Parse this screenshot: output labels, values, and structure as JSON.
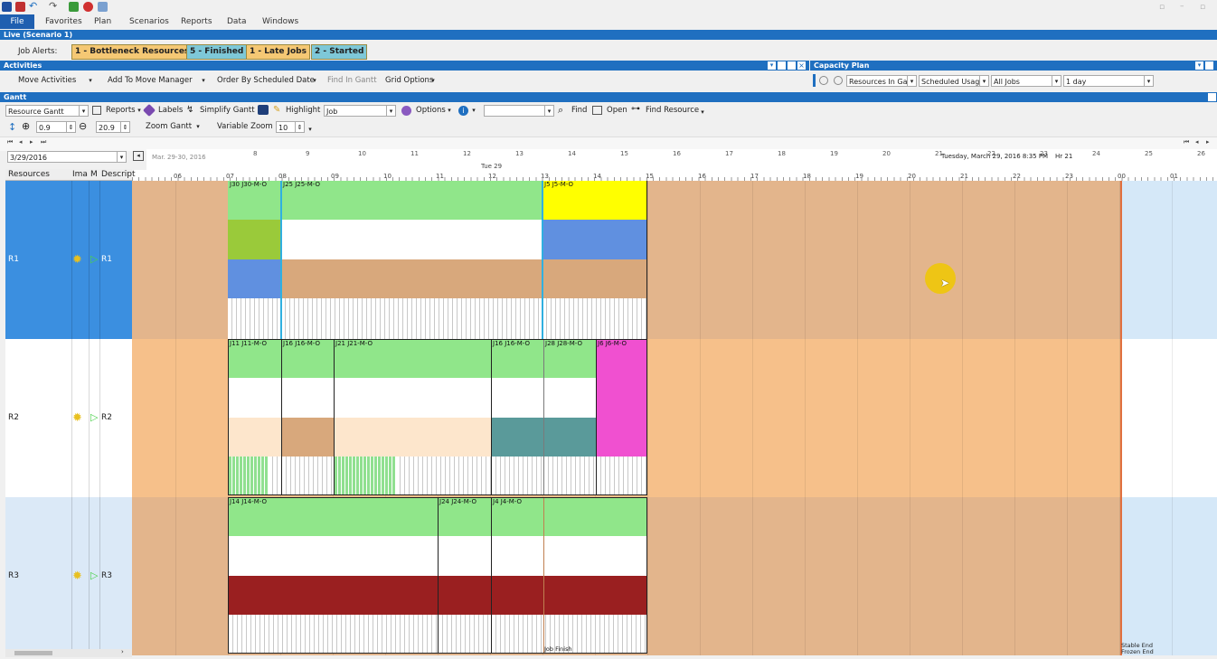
{
  "window": {
    "title_controls": [
      "restore",
      "minimize",
      "maximize"
    ]
  },
  "menu": [
    "File",
    "Favorites",
    "Plan",
    "Scenarios",
    "Reports",
    "Data",
    "Windows"
  ],
  "scenario_bar": "Live (Scenario 1)",
  "alerts": {
    "label": "Job Alerts:",
    "items": [
      {
        "label": "1 - Bottleneck Resources",
        "color": "#f5c874"
      },
      {
        "label": "5 - Finished",
        "color": "#7ec8d8"
      },
      {
        "label": "1 - Late Jobs",
        "color": "#f5c874"
      },
      {
        "label": "2 - Started",
        "color": "#7ec8d8"
      }
    ]
  },
  "activities": {
    "title": "Activities",
    "move_activities": "Move Activities",
    "add_to_move_manager": "Add To Move Manager",
    "order_by": "Order By Scheduled Date",
    "find_in_gantt": "Find In Gantt",
    "grid_options": "Grid Options"
  },
  "capacity_plan": {
    "title": "Capacity Plan",
    "resources": "Resources In Ga",
    "usage": "Scheduled Usag",
    "jobs": "All Jobs",
    "period": "1 day"
  },
  "gantt": {
    "title": "Gantt",
    "view": "Resource Gantt",
    "reports": "Reports",
    "labels": "Labels",
    "simplify": "Simplify Gantt",
    "highlight": "Highlight",
    "highlight_value": "Job",
    "options": "Options",
    "find": "Find",
    "open": "Open",
    "find_resource": "Find Resource",
    "zoom1": "0.9",
    "zoom2": "20.9",
    "zoom_gantt": "Zoom Gantt",
    "variable_zoom": "Variable Zoom",
    "variable_zoom_value": "10",
    "date": "3/29/2016",
    "date_range": "Mar. 29-30, 2016",
    "day_label": "Tue 29",
    "status_time": "Tuesday, March 29, 2016  8:35 PM",
    "status_hr": "Hr 21",
    "columns": [
      "Resources",
      "Ima",
      "M",
      "Descript"
    ],
    "top_ticks": [
      "8",
      "9",
      "10",
      "11",
      "12",
      "13",
      "14",
      "15",
      "16",
      "17",
      "18",
      "19",
      "20",
      "21",
      "22",
      "23",
      "24",
      "25",
      "26"
    ],
    "hour_ticks": [
      "06",
      "07",
      "08",
      "09",
      "10",
      "11",
      "12",
      "13",
      "14",
      "15",
      "16",
      "17",
      "18",
      "19",
      "20",
      "21",
      "22",
      "23",
      "00",
      "01"
    ],
    "stable_end": "Stable End",
    "frozen_end": "Frozen End",
    "job_finish": "Job Finish"
  },
  "resources": [
    {
      "name": "R1",
      "desc": "R1"
    },
    {
      "name": "R2",
      "desc": "R2"
    },
    {
      "name": "R3",
      "desc": "R3"
    }
  ],
  "jobs": {
    "r1": [
      "J30 J30-M-O",
      "J25 J25-M-O",
      "J5 J5-M-O"
    ],
    "r2": [
      "J11 J11-M-O",
      "J16 J16-M-O",
      "J21 J21-M-O",
      "J16 J16-M-O",
      "J28 J28-M-O",
      "J6 J6-M-O"
    ],
    "r3": [
      "J14 J14-M-O",
      "J24 J24-M-O",
      "J4 J4-M-O"
    ]
  }
}
